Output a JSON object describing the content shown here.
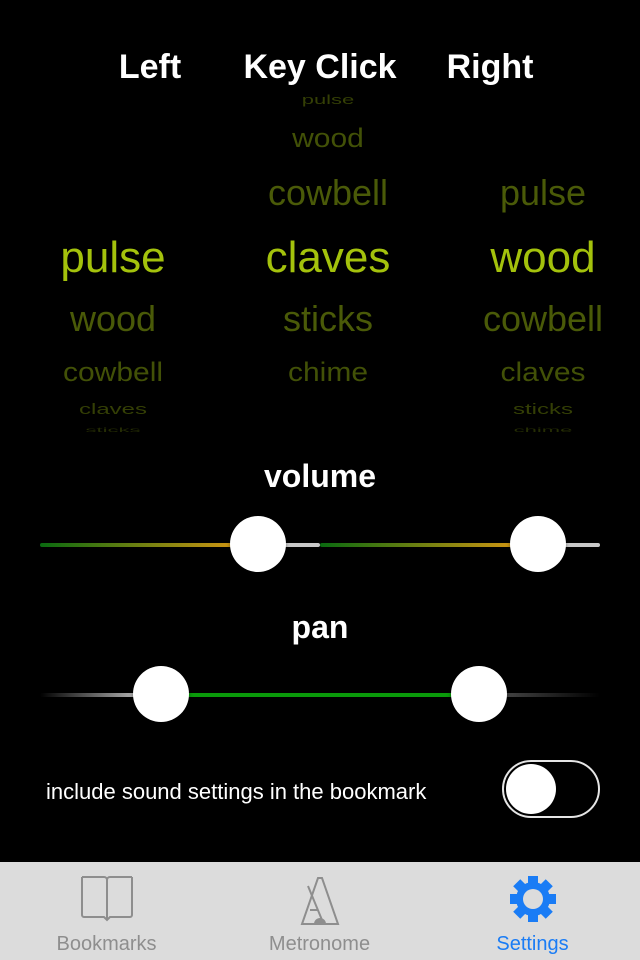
{
  "headers": {
    "left": "Left",
    "key_click": "Key Click",
    "right": "Right"
  },
  "pickers": [
    {
      "name": "left",
      "items": [
        "pulse",
        "wood",
        "cowbell",
        "claves",
        "sticks"
      ],
      "selected_index": 0
    },
    {
      "name": "key-click",
      "items": [
        "pulse",
        "wood",
        "cowbell",
        "claves",
        "sticks",
        "chime"
      ],
      "selected_index": 3
    },
    {
      "name": "right",
      "items": [
        "pulse",
        "wood",
        "cowbell",
        "claves",
        "sticks",
        "chime"
      ],
      "selected_index": 1
    }
  ],
  "colors": {
    "selected": "#a4c20c",
    "unselected": "#4a5a08",
    "active_tab": "#1a7cf5",
    "pan_fill": "#0a9a0a"
  },
  "volume": {
    "label": "volume",
    "left_level": 0.85,
    "right_level": 0.85
  },
  "pan": {
    "label": "pan",
    "left_value": -0.63,
    "right_value": 0.63
  },
  "toggle": {
    "label": "include sound settings in the bookmark",
    "on": false
  },
  "tabs": [
    {
      "label": "Bookmarks",
      "icon": "book-icon",
      "active": false
    },
    {
      "label": "Metronome",
      "icon": "metronome-icon",
      "active": false
    },
    {
      "label": "Settings",
      "icon": "gear-icon",
      "active": true
    }
  ]
}
